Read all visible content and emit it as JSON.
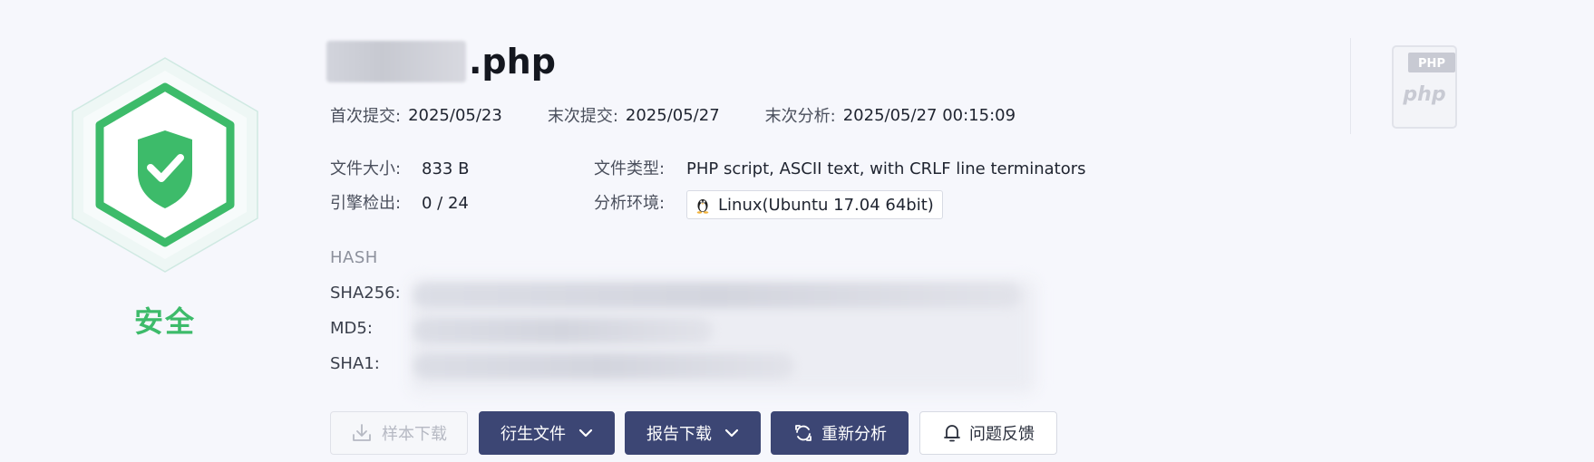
{
  "verdict": {
    "label": "安全",
    "icon": "shield-check-icon",
    "color": "#3dbb6a"
  },
  "file": {
    "name_suffix": ".php",
    "type_icon_label": "PHP",
    "type_icon_text": "php"
  },
  "dates": {
    "first_submit_label": "首次提交:",
    "first_submit_value": "2025/05/23",
    "last_submit_label": "末次提交:",
    "last_submit_value": "2025/05/27",
    "last_analysis_label": "末次分析:",
    "last_analysis_value": "2025/05/27 00:15:09"
  },
  "details": {
    "size_label": "文件大小:",
    "size_value": "833 B",
    "type_label": "文件类型:",
    "type_value": "PHP script, ASCII text, with CRLF line terminators",
    "detection_label": "引擎检出:",
    "detection_value": "0 / 24",
    "env_label": "分析环境:",
    "env_value": "Linux(Ubuntu 17.04 64bit)",
    "env_icon": "linux-penguin-icon"
  },
  "hash": {
    "title": "HASH",
    "sha256_label": "SHA256:",
    "md5_label": "MD5:",
    "sha1_label": "SHA1:"
  },
  "actions": {
    "download_sample": "样本下载",
    "derived_files": "衍生文件",
    "report_download": "报告下载",
    "reanalyze": "重新分析",
    "feedback": "问题反馈"
  },
  "colors": {
    "accent": "#3c4674",
    "safe": "#3dbb6a",
    "background": "#f6f7fc"
  }
}
